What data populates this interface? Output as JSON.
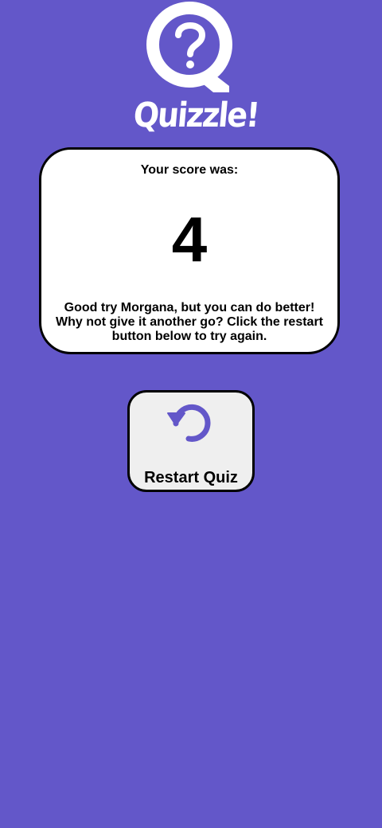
{
  "app": {
    "name": "Quizzle!"
  },
  "logo": {
    "icon": "question-mark-icon"
  },
  "result": {
    "heading": "Your score was:",
    "score": "4",
    "message": "Good try Morgana, but you can do better! Why not give it another go? Click the restart button below to try again."
  },
  "restart": {
    "label": "Restart Quiz",
    "icon": "restart-icon"
  },
  "colors": {
    "background": "#6357c9",
    "card": "#ffffff",
    "button": "#efefef",
    "accent": "#6357c9"
  }
}
